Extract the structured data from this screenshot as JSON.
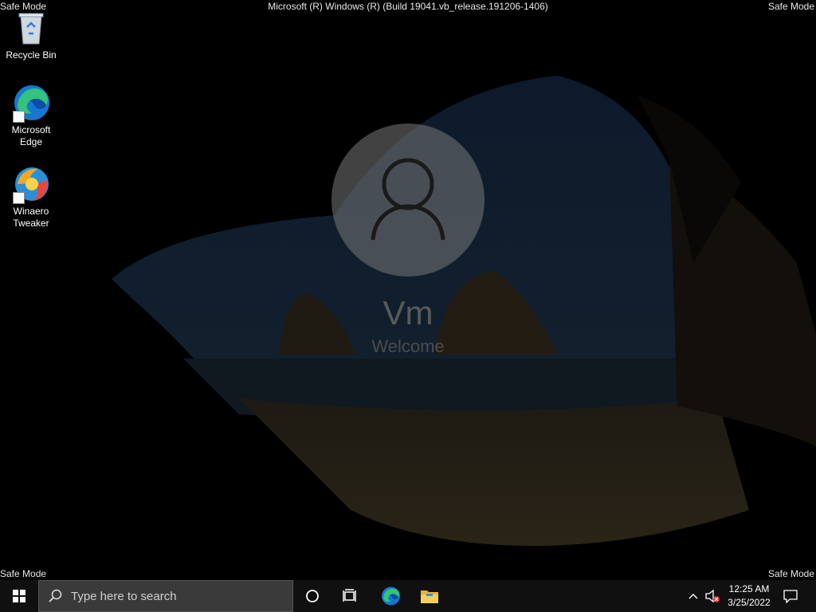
{
  "overlay": {
    "safe_mode_label": "Safe Mode",
    "build_text": "Microsoft (R) Windows (R) (Build 19041.vb_release.191206-1406)"
  },
  "desktop": {
    "icons": [
      {
        "label": "Recycle Bin",
        "icon": "recycle-bin-icon"
      },
      {
        "label": "Microsoft Edge",
        "icon": "edge-icon"
      },
      {
        "label": "Winaero Tweaker",
        "icon": "winaero-tweaker-icon"
      }
    ]
  },
  "login": {
    "username": "Vm",
    "status": "Welcome"
  },
  "taskbar": {
    "search_placeholder": "Type here to search",
    "pinned": [
      "cortana-icon",
      "task-view-icon",
      "edge-icon",
      "file-explorer-icon"
    ],
    "clock_time": "12:25 AM",
    "clock_date": "3/25/2022"
  },
  "colors": {
    "taskbar_bg": "#101010",
    "search_bg": "#3a3a3a",
    "username_color": "#5a5a5a"
  }
}
